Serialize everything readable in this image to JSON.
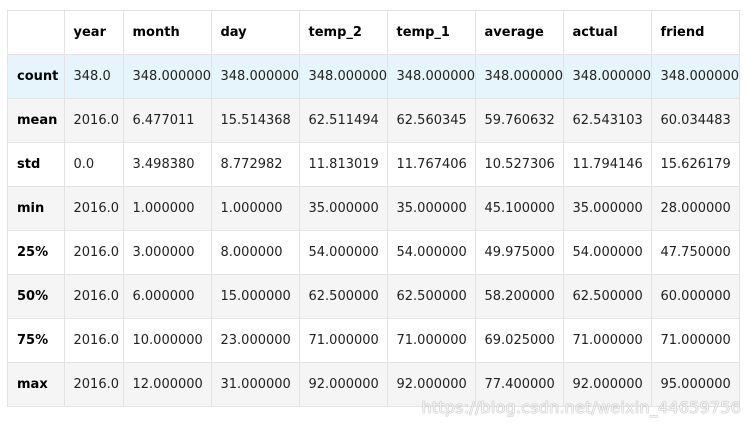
{
  "table": {
    "columns": [
      "",
      "year",
      "month",
      "day",
      "temp_2",
      "temp_1",
      "average",
      "actual",
      "friend"
    ],
    "rows": [
      {
        "label": "count",
        "values": [
          "348.0",
          "348.000000",
          "348.000000",
          "348.000000",
          "348.000000",
          "348.000000",
          "348.000000",
          "348.000000"
        ]
      },
      {
        "label": "mean",
        "values": [
          "2016.0",
          "6.477011",
          "15.514368",
          "62.511494",
          "62.560345",
          "59.760632",
          "62.543103",
          "60.034483"
        ]
      },
      {
        "label": "std",
        "values": [
          "0.0",
          "3.498380",
          "8.772982",
          "11.813019",
          "11.767406",
          "10.527306",
          "11.794146",
          "15.626179"
        ]
      },
      {
        "label": "min",
        "values": [
          "2016.0",
          "1.000000",
          "1.000000",
          "35.000000",
          "35.000000",
          "45.100000",
          "35.000000",
          "28.000000"
        ]
      },
      {
        "label": "25%",
        "values": [
          "2016.0",
          "3.000000",
          "8.000000",
          "54.000000",
          "54.000000",
          "49.975000",
          "54.000000",
          "47.750000"
        ]
      },
      {
        "label": "50%",
        "values": [
          "2016.0",
          "6.000000",
          "15.000000",
          "62.500000",
          "62.500000",
          "58.200000",
          "62.500000",
          "60.000000"
        ]
      },
      {
        "label": "75%",
        "values": [
          "2016.0",
          "10.000000",
          "23.000000",
          "71.000000",
          "71.000000",
          "69.025000",
          "71.000000",
          "71.000000"
        ]
      },
      {
        "label": "max",
        "values": [
          "2016.0",
          "12.000000",
          "31.000000",
          "92.000000",
          "92.000000",
          "77.400000",
          "92.000000",
          "95.000000"
        ]
      }
    ]
  },
  "watermark": "https://blog.csdn.net/weixin_44659756",
  "colors": {
    "highlight_row": "#e6f4fb",
    "striped_row": "#f5f5f5",
    "border": "#e3e3e3"
  }
}
